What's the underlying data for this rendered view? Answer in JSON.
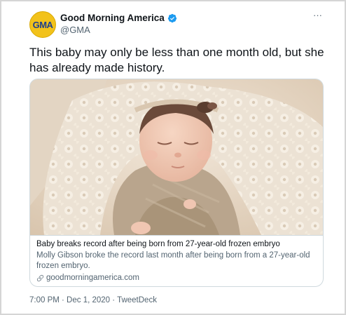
{
  "tweet": {
    "display_name": "Good Morning America",
    "handle": "@GMA",
    "avatar_text": "GMA",
    "more_label": "···",
    "text": "This baby may only be less than one month old, but she has already made history.",
    "timestamp": "7:00 PM · Dec 1, 2020 · TweetDeck"
  },
  "card": {
    "title": "Baby breaks record after being born from 27-year-old frozen embryo",
    "description": "Molly Gibson broke the record last month after being born from a 27-year-old frozen embryo.",
    "domain": "goodmorningamerica.com"
  },
  "icons": {
    "verified": "verified-badge-icon",
    "link": "link-icon",
    "more": "more-icon"
  },
  "colors": {
    "verified_blue": "#1d9bf0",
    "avatar_yellow": "#f2c21b",
    "avatar_text_blue": "#1d3f8f",
    "secondary_text": "#536471"
  }
}
